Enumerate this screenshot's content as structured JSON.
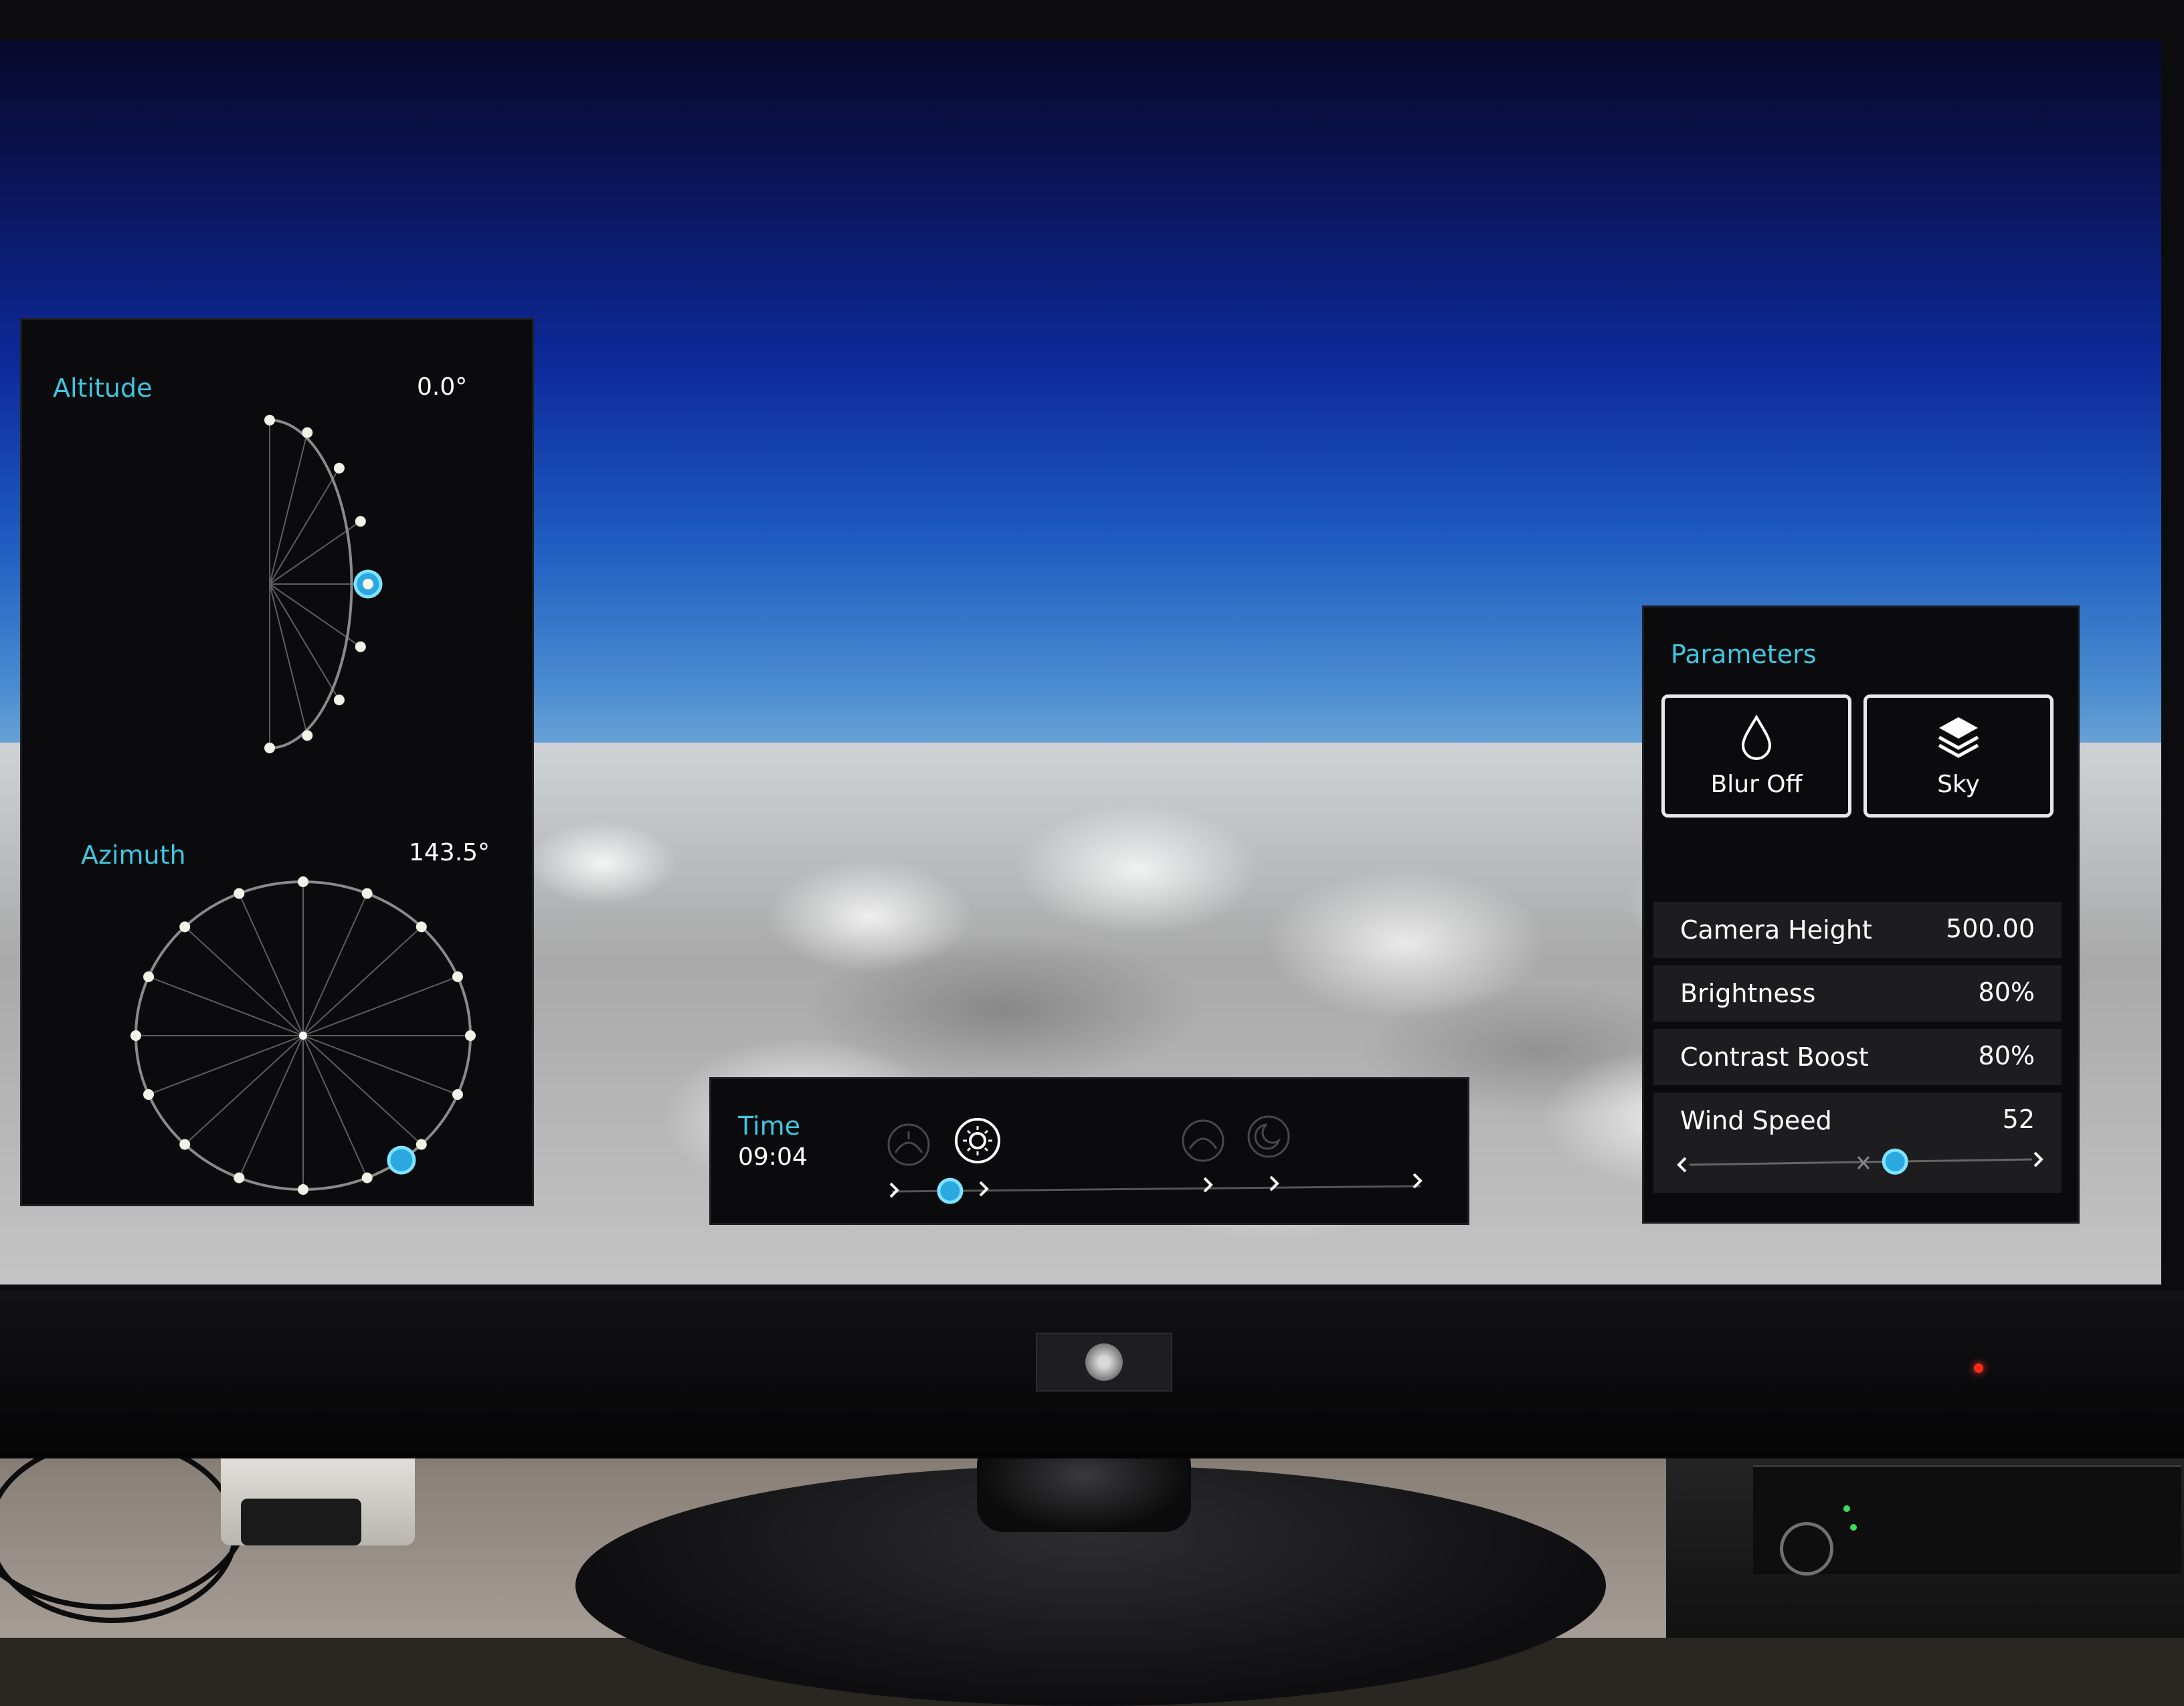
{
  "altitude": {
    "title": "Altitude",
    "value": "0.0°",
    "level": 0.5
  },
  "azimuth": {
    "title": "Azimuth",
    "value": "143.5°",
    "level": 0.4
  },
  "time": {
    "title": "Time",
    "value": "09:04",
    "phase_icons": [
      "sunrise-icon",
      "sun-icon",
      "sunset-icon",
      "moon-icon"
    ],
    "progress": 0.11
  },
  "parameters": {
    "title": "Parameters",
    "blur_label": "Blur Off",
    "blur_icon": "droplet-icon",
    "sky_label": "Sky",
    "sky_icon": "layers-icon",
    "rows": [
      {
        "label": "Camera Height",
        "value": "500.00"
      },
      {
        "label": "Brightness",
        "value": "80%"
      },
      {
        "label": "Contrast Boost",
        "value": "80%"
      },
      {
        "label": "Wind Speed",
        "value": "52"
      }
    ],
    "wind_slider_level": 0.6
  },
  "colors": {
    "accent": "#3fc6e0",
    "panel_bg": "#0b0b0d",
    "row_bg": "#1d1d20",
    "knob": "#2aa8e0"
  }
}
